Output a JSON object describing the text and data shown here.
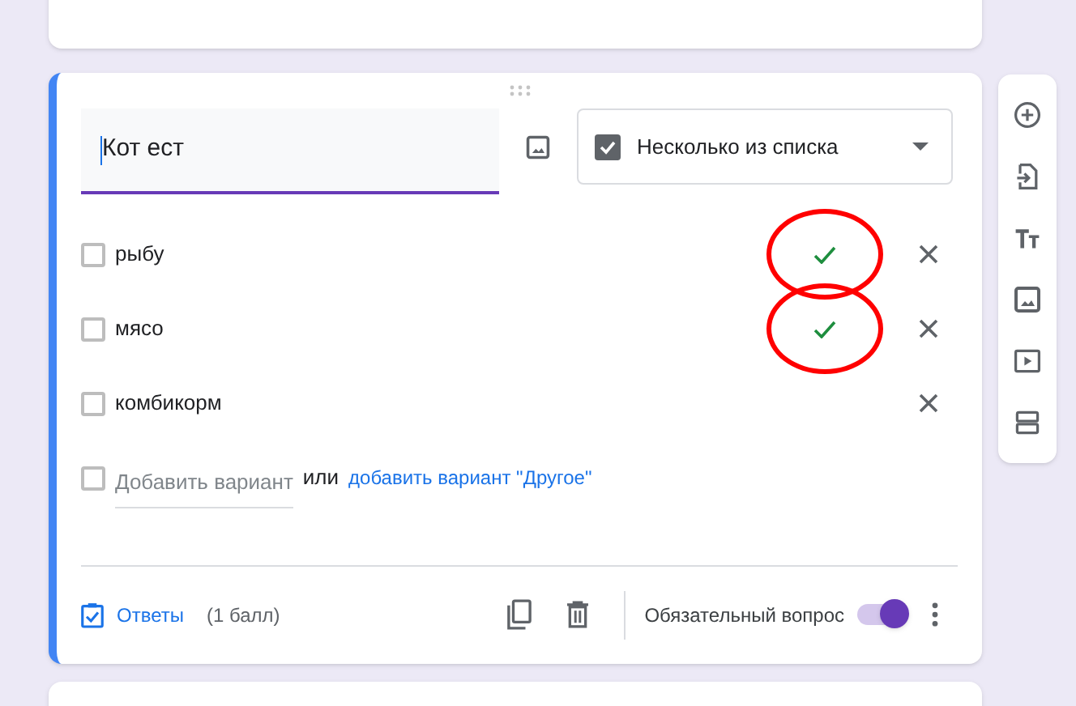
{
  "question": {
    "title": "Кот ест",
    "type_label": "Несколько из списка",
    "type_checked": true
  },
  "options": [
    {
      "label": "рыбу",
      "checked": false,
      "correct": true,
      "circled": true
    },
    {
      "label": "мясо",
      "checked": false,
      "correct": true,
      "circled": true
    },
    {
      "label": "комбикорм",
      "checked": false,
      "correct": false,
      "circled": false
    }
  ],
  "add_option": {
    "checked": false,
    "placeholder": "Добавить вариант",
    "or": "или",
    "other_link": "добавить вариант \"Другое\""
  },
  "footer": {
    "answers": "Ответы",
    "points": "(1 балл)",
    "required_label": "Обязательный вопрос",
    "required_on": true
  },
  "sidebar": [
    {
      "kind": "add"
    },
    {
      "kind": "import"
    },
    {
      "kind": "title"
    },
    {
      "kind": "image"
    },
    {
      "kind": "video"
    },
    {
      "kind": "section"
    }
  ]
}
